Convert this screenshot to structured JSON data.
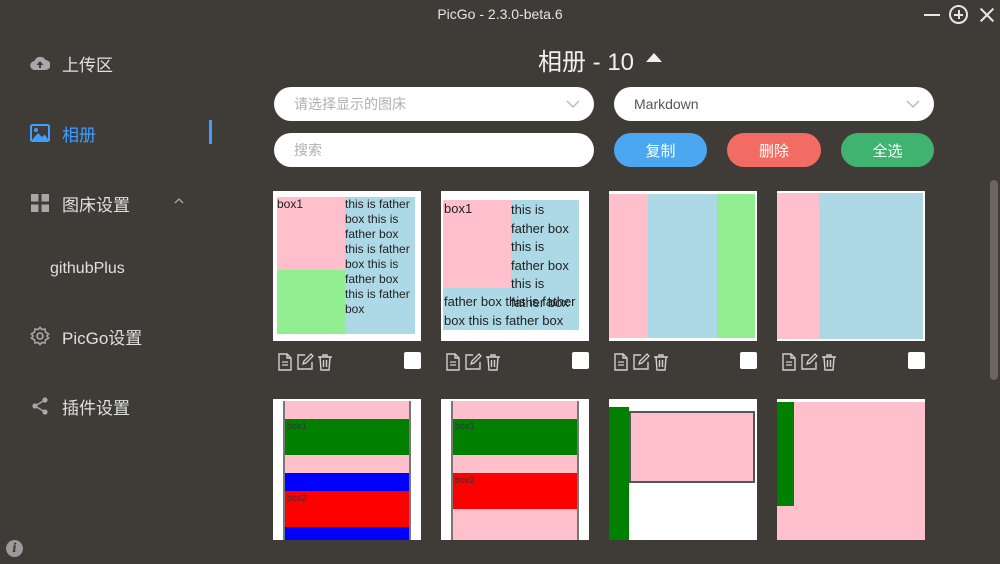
{
  "window": {
    "title": "PicGo - 2.3.0-beta.6"
  },
  "sidebar": {
    "items": [
      {
        "label": "上传区",
        "icon": "cloud-upload-icon"
      },
      {
        "label": "相册",
        "icon": "image-icon",
        "active": true
      },
      {
        "label": "图床设置",
        "icon": "grid-icon",
        "expanded": true
      },
      {
        "label": "PicGo设置",
        "icon": "gear-icon"
      },
      {
        "label": "插件设置",
        "icon": "share-icon"
      }
    ],
    "sub_items": [
      {
        "label": "githubPlus"
      }
    ]
  },
  "header": {
    "title": "相册 - 10"
  },
  "filters": {
    "bed_select_placeholder": "请选择显示的图床",
    "format_select_value": "Markdown",
    "search_placeholder": "搜索"
  },
  "buttons": {
    "copy": "复制",
    "delete": "删除",
    "select_all": "全选"
  },
  "gallery": {
    "thumb1": {
      "label": "box1",
      "text": "this is father box this is father box this is father box this is father box this is father box"
    },
    "thumb2": {
      "label": "box1",
      "text_right": "this is father box this is father box this is father box",
      "text_bottom": "father box this is father box this is father box"
    },
    "thumb5": {
      "labels": [
        "box1",
        "box2"
      ]
    },
    "thumb6": {
      "labels": [
        "box1",
        "box2"
      ]
    }
  },
  "colors": {
    "accent": "#409eff",
    "copy": "#4aa7f0",
    "delete": "#f26c64",
    "select_all": "#3fb36f",
    "background": "#3f3b37"
  }
}
